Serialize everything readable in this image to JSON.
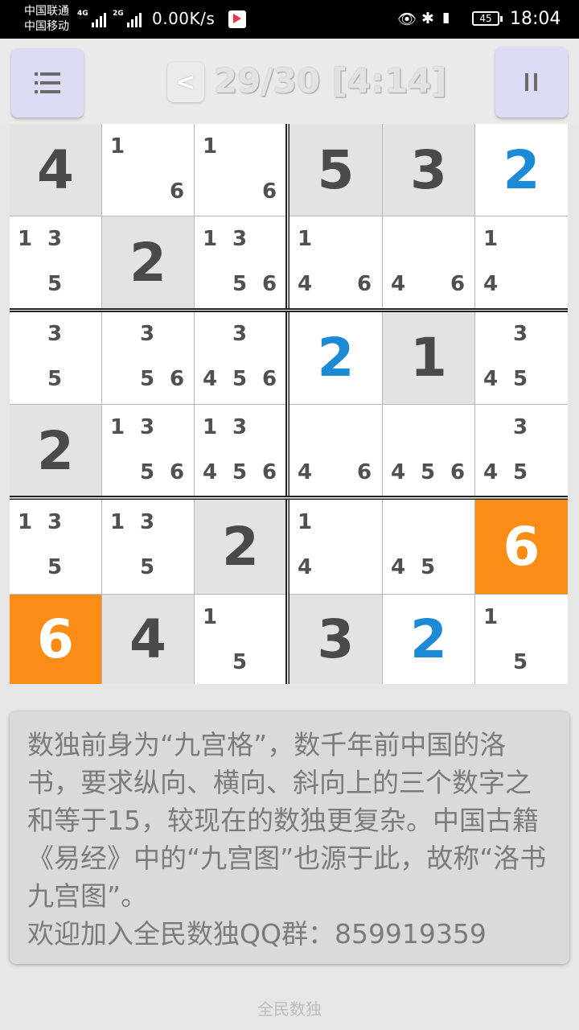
{
  "status_bar": {
    "carrier1": "中国联通",
    "carrier2": "中国移动",
    "network1": "4G",
    "network2": "2G",
    "net_speed": "0.00K/s",
    "battery": "45",
    "time": "18:04"
  },
  "header": {
    "back_label": "<",
    "progress": "29/30 [4:14]",
    "menu_icon": "menu-icon",
    "pause_icon": "pause-icon"
  },
  "board": {
    "rows": [
      [
        {
          "v": "4",
          "t": "given"
        },
        {
          "n": [
            "1",
            "6"
          ],
          "t": "blank"
        },
        {
          "n": [
            "1",
            "6"
          ],
          "t": "blank"
        },
        {
          "v": "5",
          "t": "given"
        },
        {
          "v": "3",
          "t": "given"
        },
        {
          "v": "2",
          "t": "filled"
        }
      ],
      [
        {
          "n": [
            "1",
            "3",
            "5"
          ],
          "t": "blank"
        },
        {
          "v": "2",
          "t": "given"
        },
        {
          "n": [
            "1",
            "3",
            "5",
            "6"
          ],
          "t": "blank"
        },
        {
          "n": [
            "1",
            "4",
            "6"
          ],
          "t": "blank"
        },
        {
          "n": [
            "4",
            "6"
          ],
          "t": "blank"
        },
        {
          "n": [
            "1",
            "4"
          ],
          "t": "blank"
        }
      ],
      [
        {
          "n": [
            "3",
            "5"
          ],
          "t": "blank"
        },
        {
          "n": [
            "3",
            "5",
            "6"
          ],
          "t": "blank"
        },
        {
          "n": [
            "3",
            "4",
            "5",
            "6"
          ],
          "t": "blank"
        },
        {
          "v": "2",
          "t": "filled"
        },
        {
          "v": "1",
          "t": "given"
        },
        {
          "n": [
            "3",
            "4",
            "5"
          ],
          "t": "blank"
        }
      ],
      [
        {
          "v": "2",
          "t": "given"
        },
        {
          "n": [
            "1",
            "3",
            "5",
            "6"
          ],
          "t": "blank"
        },
        {
          "n": [
            "1",
            "3",
            "4",
            "5",
            "6"
          ],
          "t": "blank"
        },
        {
          "n": [
            "4",
            "6"
          ],
          "t": "blank"
        },
        {
          "n": [
            "4",
            "5",
            "6"
          ],
          "t": "blank"
        },
        {
          "n": [
            "3",
            "4",
            "5"
          ],
          "t": "blank"
        }
      ],
      [
        {
          "n": [
            "1",
            "3",
            "5"
          ],
          "t": "blank"
        },
        {
          "n": [
            "1",
            "3",
            "5"
          ],
          "t": "blank"
        },
        {
          "v": "2",
          "t": "given"
        },
        {
          "n": [
            "1",
            "4"
          ],
          "t": "blank"
        },
        {
          "n": [
            "4",
            "5"
          ],
          "t": "blank"
        },
        {
          "v": "6",
          "t": "highlight"
        }
      ],
      [
        {
          "v": "6",
          "t": "highlight"
        },
        {
          "v": "4",
          "t": "given"
        },
        {
          "n": [
            "1",
            "5"
          ],
          "t": "blank"
        },
        {
          "v": "3",
          "t": "given"
        },
        {
          "v": "2",
          "t": "filled"
        },
        {
          "n": [
            "1",
            "5"
          ],
          "t": "blank"
        }
      ]
    ]
  },
  "info": {
    "text": "数独前身为“九宫格”，数千年前中国的洛书，要求纵向、横向、斜向上的三个数字之和等于15，较现在的数独更复杂。中国古籍《易经》中的“九宫图”也源于此，故称“洛书九宫图”。",
    "qq_line": "欢迎加入全民数独QQ群：859919359"
  },
  "footer": "全民数独",
  "colors": {
    "highlight": "#fb8c16",
    "filled_digit": "#1d8ad6",
    "given_bg": "#e3e3e3",
    "button_bg": "#dcdcf5"
  }
}
